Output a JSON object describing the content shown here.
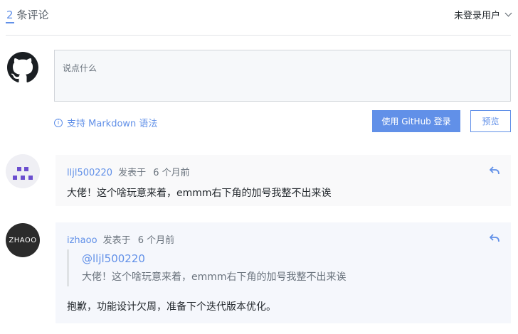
{
  "header": {
    "count": "2",
    "count_label": "条评论",
    "user_menu_label": "未登录用户"
  },
  "editor": {
    "placeholder": "说点什么",
    "markdown_hint": "支持 Markdown 语法",
    "login_button": "使用 GitHub 登录",
    "preview_button": "预览"
  },
  "comments": [
    {
      "author": "lljl500220",
      "posted_label": "发表于",
      "time": "6 个月前",
      "body": "大佬！这个啥玩意来着，emmm右下角的加号我整不出来诶"
    },
    {
      "author": "izhaoo",
      "avatar_text": "ZHAOO",
      "posted_label": "发表于",
      "time": "6 个月前",
      "quote_mention": "@lljl500220",
      "quote_text": "大佬！这个啥玩意来着，emmm右下角的加号我整不出来诶",
      "body": "抱歉，功能设计欠周，准备下个迭代版本优化。"
    }
  ],
  "colors": {
    "accent": "#6190e8",
    "avatar1_pattern": "#6b4ecf"
  },
  "icons": {
    "info": "info-icon",
    "reply": "reply-icon",
    "github": "github-icon",
    "chevron": "chevron-down-icon"
  }
}
